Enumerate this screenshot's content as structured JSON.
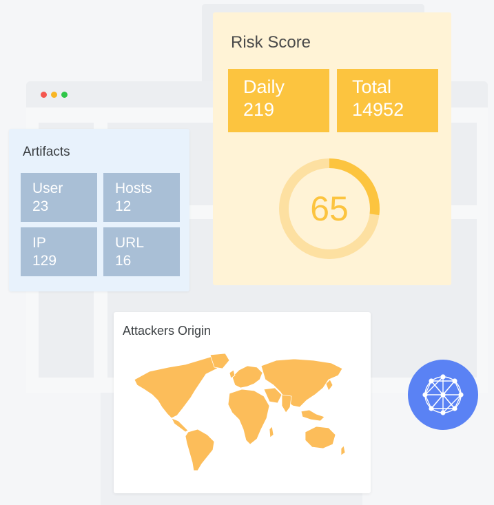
{
  "window": {
    "controls": [
      "close",
      "minimize",
      "maximize"
    ]
  },
  "artifacts": {
    "title": "Artifacts",
    "tiles": [
      {
        "label": "User",
        "value": "23"
      },
      {
        "label": "Hosts",
        "value": "12"
      },
      {
        "label": "IP",
        "value": "129"
      },
      {
        "label": "URL",
        "value": "16"
      }
    ],
    "tile_color": "#a9bfd6",
    "card_color": "#e8f2fc"
  },
  "risk_score": {
    "title": "Risk Score",
    "daily": {
      "label": "Daily",
      "value": "219"
    },
    "total": {
      "label": "Total",
      "value": "14952"
    },
    "gauge": {
      "value": "65",
      "progress_fraction": 0.27
    },
    "accent_color": "#fcc43f",
    "track_color": "#fde0a1",
    "card_color": "#fff3d6"
  },
  "attackers_origin": {
    "title": "Attackers Origin",
    "map_color": "#fcbd5a",
    "icon": "world-map"
  },
  "network_badge": {
    "icon": "neural-network-icon",
    "color": "#5a82f4"
  },
  "window_dot_colors": {
    "red": "#f4574f",
    "yellow": "#f8b624",
    "green": "#2fc648"
  }
}
